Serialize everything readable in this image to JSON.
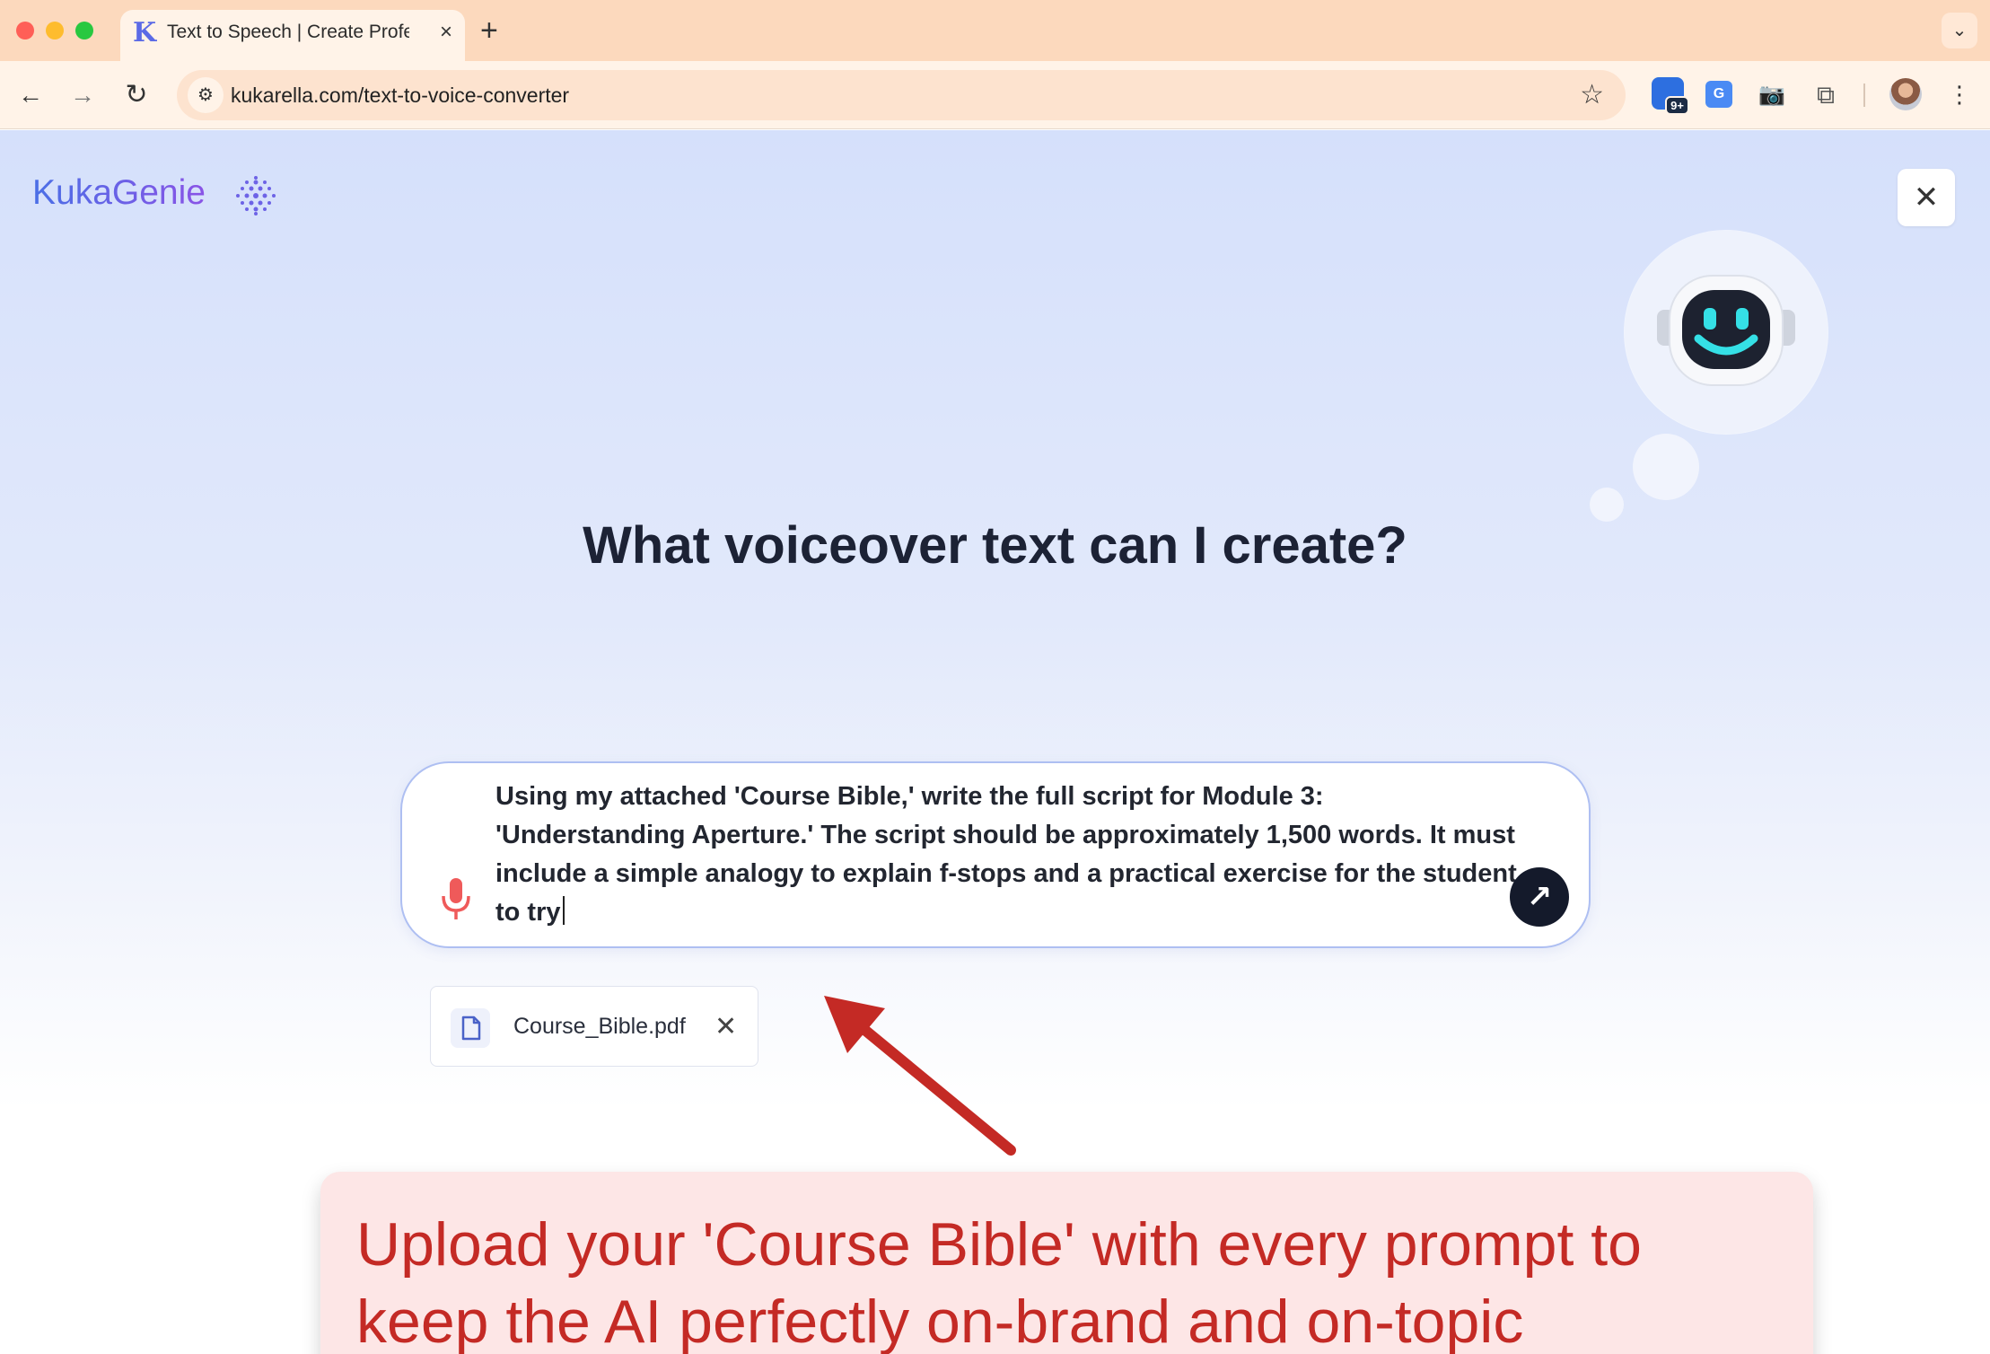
{
  "browser": {
    "tab_title": "Text to Speech | Create Professional",
    "new_tab": "+",
    "tab_close": "×",
    "url": "kukarella.com/text-to-voice-converter",
    "extension_badge": "9+",
    "translate_label": "G"
  },
  "app": {
    "brand": "KukaGenie",
    "close_label": "✕"
  },
  "main": {
    "headline": "What voiceover text can I create?",
    "prompt_text": "Using my attached 'Course Bible,' write the full script for Module 3: 'Understanding Aperture.' The script should be approximately 1,500 words. It must include a simple analogy to explain f-stops and a practical exercise for the student to try",
    "send_label": "↗",
    "attachment": {
      "file_name": "Course_Bible.pdf",
      "remove_label": "✕"
    }
  },
  "annotation": {
    "callout_text": "Upload your 'Course Bible' with every prompt to keep the AI perfectly on-brand and on-topic",
    "color": "#c42a25"
  },
  "colors": {
    "tab_bar": "#fcd9bd",
    "toolbar": "#fff3e8",
    "accent": "#141a2b",
    "brand_gradient_start": "#4a6fe6",
    "brand_gradient_end": "#8a53e6",
    "callout_bg": "#fde6e6"
  }
}
